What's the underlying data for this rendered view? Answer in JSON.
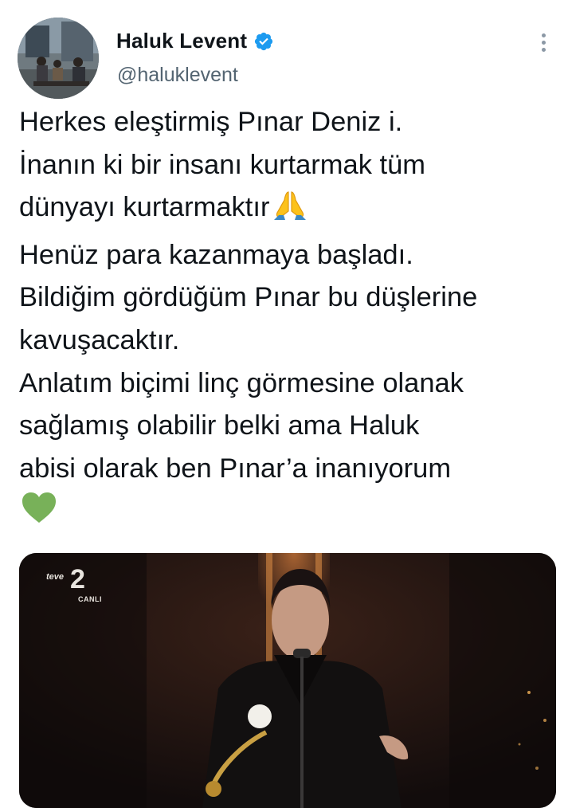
{
  "author": {
    "display_name": "Haluk Levent",
    "handle": "@haluklevent",
    "verified": true,
    "avatar_icon": "profile-photo"
  },
  "menu_icon": "more-options-icon",
  "tweet": {
    "lines": [
      "Herkes eleştirmiş Pınar Deniz i.",
      "İnanın ki bir insanı kurtarmak tüm",
      "dünyayı kurtarmaktır",
      "Henüz para kazanmaya başladı.",
      "Bildiğim gördüğüm Pınar bu düşlerine",
      "kavuşacaktır.",
      "Anlatım biçimi linç görmesine olanak",
      "sağlamış olabilir belki ama Haluk",
      "abisi olarak ben Pınar’a inanıyorum"
    ],
    "emoji_after_line_3": "folded-hands-emoji",
    "emoji_last": "green-heart-emoji"
  },
  "media": {
    "channel_logo": {
      "teve": "teve",
      "number": "2",
      "live": "CANLI"
    }
  },
  "colors": {
    "text": "#0f1419",
    "secondary": "#536471",
    "verified": "#1d9bf0",
    "heart": "#78b159",
    "hands": "#fcc21b"
  }
}
